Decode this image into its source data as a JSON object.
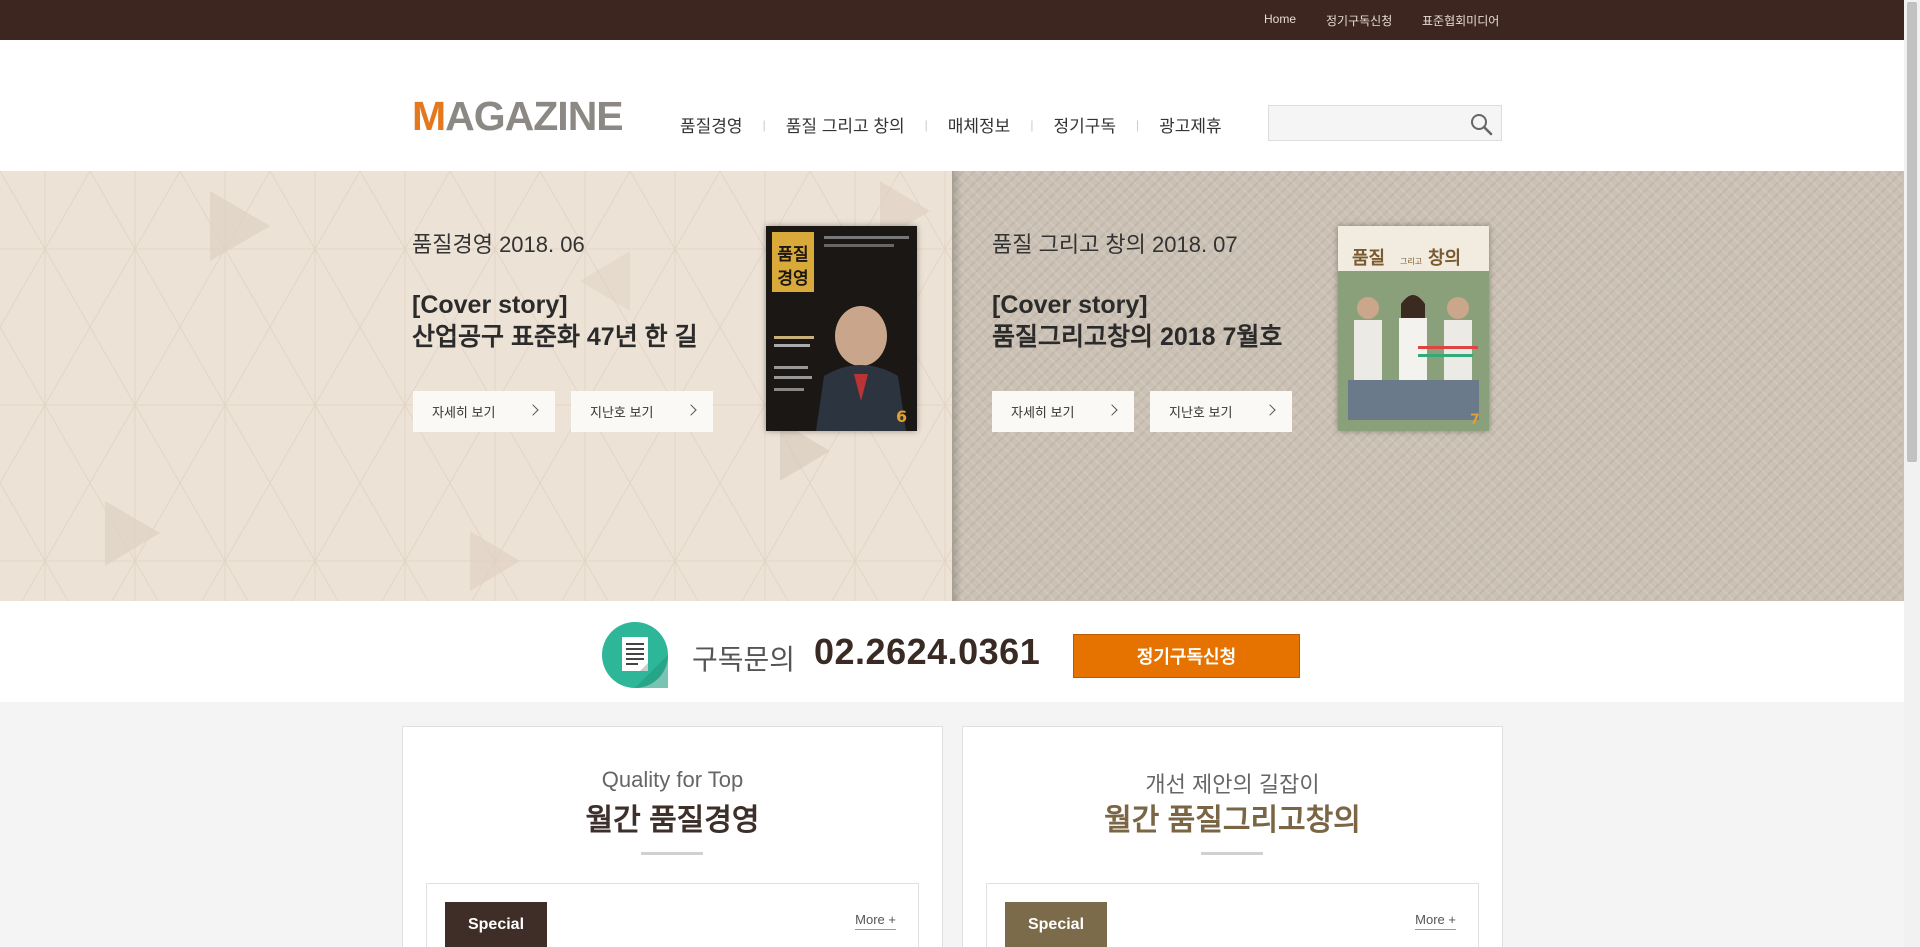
{
  "topbar": {
    "links": [
      "Home",
      "정기구독신청",
      "표준협회미디어"
    ]
  },
  "header": {
    "logo_first": "M",
    "logo_rest": "AGAZINE",
    "nav": [
      "품질경영",
      "품질 그리고 창의",
      "매체정보",
      "정기구독",
      "광고제휴"
    ],
    "search_placeholder": "",
    "search_icon": "search-icon"
  },
  "hero": {
    "left": {
      "issue": "품질경영 2018. 06",
      "cover_line1": "[Cover story]",
      "cover_line2": "산업공구 표준화 47년 한 길",
      "btn_detail": "자세히 보기",
      "btn_past": "지난호 보기",
      "cover_title_top": "품질",
      "cover_title_bottom": "경영",
      "cover_issue_no": "6"
    },
    "right": {
      "issue": "품질 그리고 창의 2018. 07",
      "cover_line1": "[Cover story]",
      "cover_line2": "품질그리고창의 2018 7월호",
      "btn_detail": "자세히 보기",
      "btn_past": "지난호 보기",
      "cover_title_a": "품질",
      "cover_title_b": "그리고",
      "cover_title_c": "창의",
      "cover_issue_no": "7"
    }
  },
  "subscribe": {
    "label": "구독문의",
    "phone": "02.2624.0361",
    "button": "정기구독신청"
  },
  "cards": [
    {
      "subtitle": "Quality for Top",
      "title": "월간 품질경영",
      "tag": "Special",
      "more": "More +",
      "title_color": "#3d2f29",
      "tag_color": "#3e2e27"
    },
    {
      "subtitle": "개선 제안의 길잡이",
      "title": "월간 품질그리고창의",
      "tag": "Special",
      "more": "More +",
      "title_color": "#7a6645",
      "tag_color": "#7b6b4a"
    }
  ],
  "colors": {
    "topbar": "#3d2520",
    "accent": "#e4781e",
    "subscribe_btn": "#e67300",
    "subscribe_icon": "#2db698"
  }
}
